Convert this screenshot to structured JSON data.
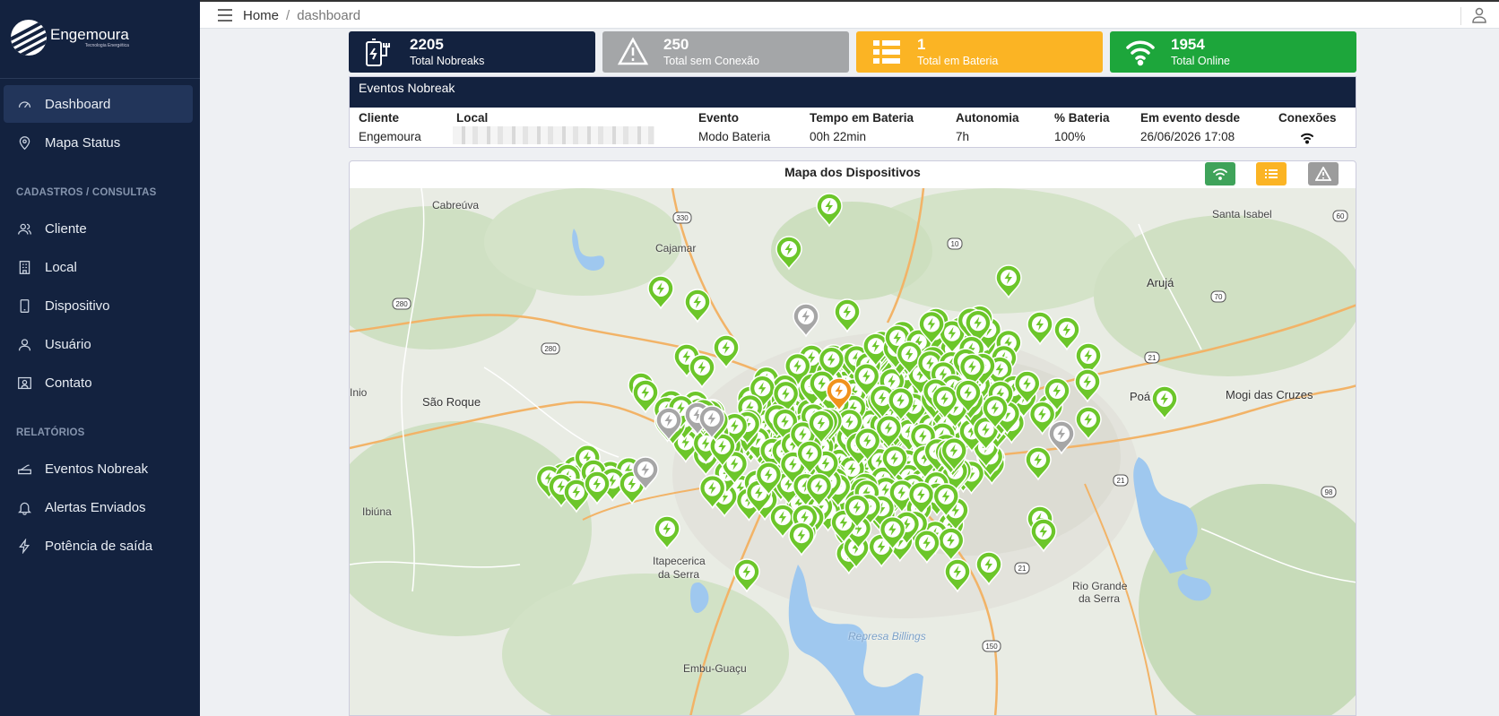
{
  "sidebar": {
    "brand": "Engemoura",
    "brand_sub": "Tecnologia Energética",
    "items": [
      {
        "label": "Dashboard",
        "icon": "gauge-icon"
      },
      {
        "label": "Mapa Status",
        "icon": "map-pin-icon"
      }
    ],
    "section_cadastros": "CADASTROS / CONSULTAS",
    "cadastros": [
      {
        "label": "Cliente",
        "icon": "users-icon"
      },
      {
        "label": "Local",
        "icon": "building-icon"
      },
      {
        "label": "Dispositivo",
        "icon": "device-icon"
      },
      {
        "label": "Usuário",
        "icon": "user-icon"
      },
      {
        "label": "Contato",
        "icon": "contact-icon"
      }
    ],
    "section_relatorios": "RELATÓRIOS",
    "relatorios": [
      {
        "label": "Eventos Nobreak",
        "icon": "router-icon"
      },
      {
        "label": "Alertas Enviados",
        "icon": "bell-icon"
      },
      {
        "label": "Potência de saída",
        "icon": "lightning-icon"
      }
    ]
  },
  "breadcrumb": {
    "home": "Home",
    "separator": "/",
    "current": "dashboard"
  },
  "cards": [
    {
      "value": "2205",
      "label": "Total Nobreaks",
      "color": "#13223f"
    },
    {
      "value": "250",
      "label": "Total sem Conexão",
      "color": "#a4a6a8"
    },
    {
      "value": "1",
      "label": "Total em Bateria",
      "color": "#fbb424"
    },
    {
      "value": "1954",
      "label": "Total Online",
      "color": "#1da63b"
    }
  ],
  "events": {
    "title": "Eventos Nobreak",
    "headers": [
      "Cliente",
      "Local",
      "Evento",
      "Tempo em Bateria",
      "Autonomia",
      "% Bateria",
      "Em evento desde",
      "Conexões"
    ],
    "row": {
      "cliente": "Engemoura",
      "evento": "Modo Bateria",
      "tempo": "00h 22min",
      "autonomia": "7h",
      "bateria": "100%",
      "desde": "26/06/2026 17:08"
    }
  },
  "map": {
    "title": "Mapa dos Dispositivos",
    "towns": [
      "Cabreúva",
      "Cajamar",
      "Santa Isabel",
      "Arujá",
      "São Roque",
      "Poá",
      "Mogi das Cruzes",
      "Ibiúna",
      "Itapecerica",
      "da Serra",
      "Rio Grande",
      "da Serra",
      "Embu-Guaçu",
      "Represa Billings",
      "Inio"
    ],
    "road_shields": [
      "330",
      "10",
      "60",
      "280",
      "280",
      "70",
      "21",
      "21",
      "98",
      "21",
      "150"
    ],
    "colors": {
      "online": "#6cc62a",
      "offline": "#a6a6a6",
      "battery": "#f0921c"
    }
  }
}
